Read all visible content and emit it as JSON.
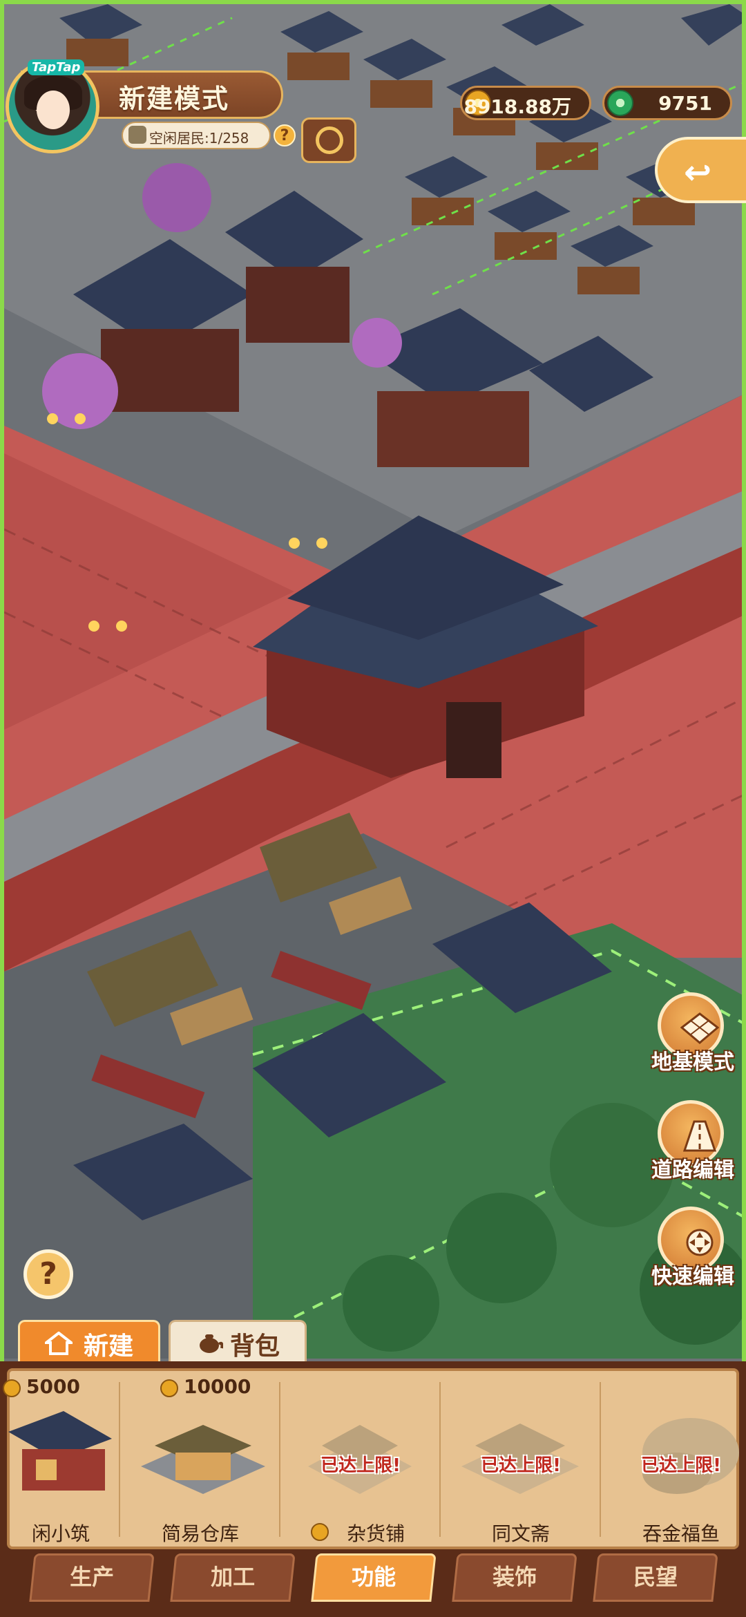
{
  "hud": {
    "badge": "TapTap",
    "mode_title": "新建模式",
    "residents_label": "空闲居民:1/258",
    "help_glyph": "?",
    "gold_amount": "8918.88万",
    "jade_amount": "9751",
    "exit_glyph": "↩"
  },
  "side_tools": [
    {
      "label": "地基模式",
      "icon": "foundation-grid-icon"
    },
    {
      "label": "道路编辑",
      "icon": "road-icon"
    },
    {
      "label": "快速编辑",
      "icon": "move-arrows-icon"
    }
  ],
  "help_button": "?",
  "panel_tabs": {
    "new": "新建",
    "bag": "背包"
  },
  "cards": [
    {
      "price": "5000",
      "name": "安闲小筑",
      "name_visible": "闲小筑",
      "locked": false
    },
    {
      "price": "10000",
      "name": "简易仓库",
      "locked": false
    },
    {
      "price": "",
      "name": "杂货铺",
      "locked": true,
      "limit_text": "已达上限!"
    },
    {
      "price": "",
      "name": "同文斋",
      "locked": true,
      "limit_text": "已达上限!"
    },
    {
      "price": "",
      "name": "吞金福鱼",
      "locked": true,
      "limit_text": "已达上限!"
    }
  ],
  "categories": [
    {
      "label": "生产",
      "active": false
    },
    {
      "label": "加工",
      "active": false
    },
    {
      "label": "功能",
      "active": true
    },
    {
      "label": "装饰",
      "active": false
    },
    {
      "label": "民望",
      "active": false
    }
  ],
  "colors": {
    "accent_orange": "#f29a3c",
    "panel_brown": "#5b2c18",
    "card_bg": "#e7c291",
    "road_red": "#c45a55",
    "grass_green": "#3f7a4a",
    "border_green": "#8bd94a"
  }
}
